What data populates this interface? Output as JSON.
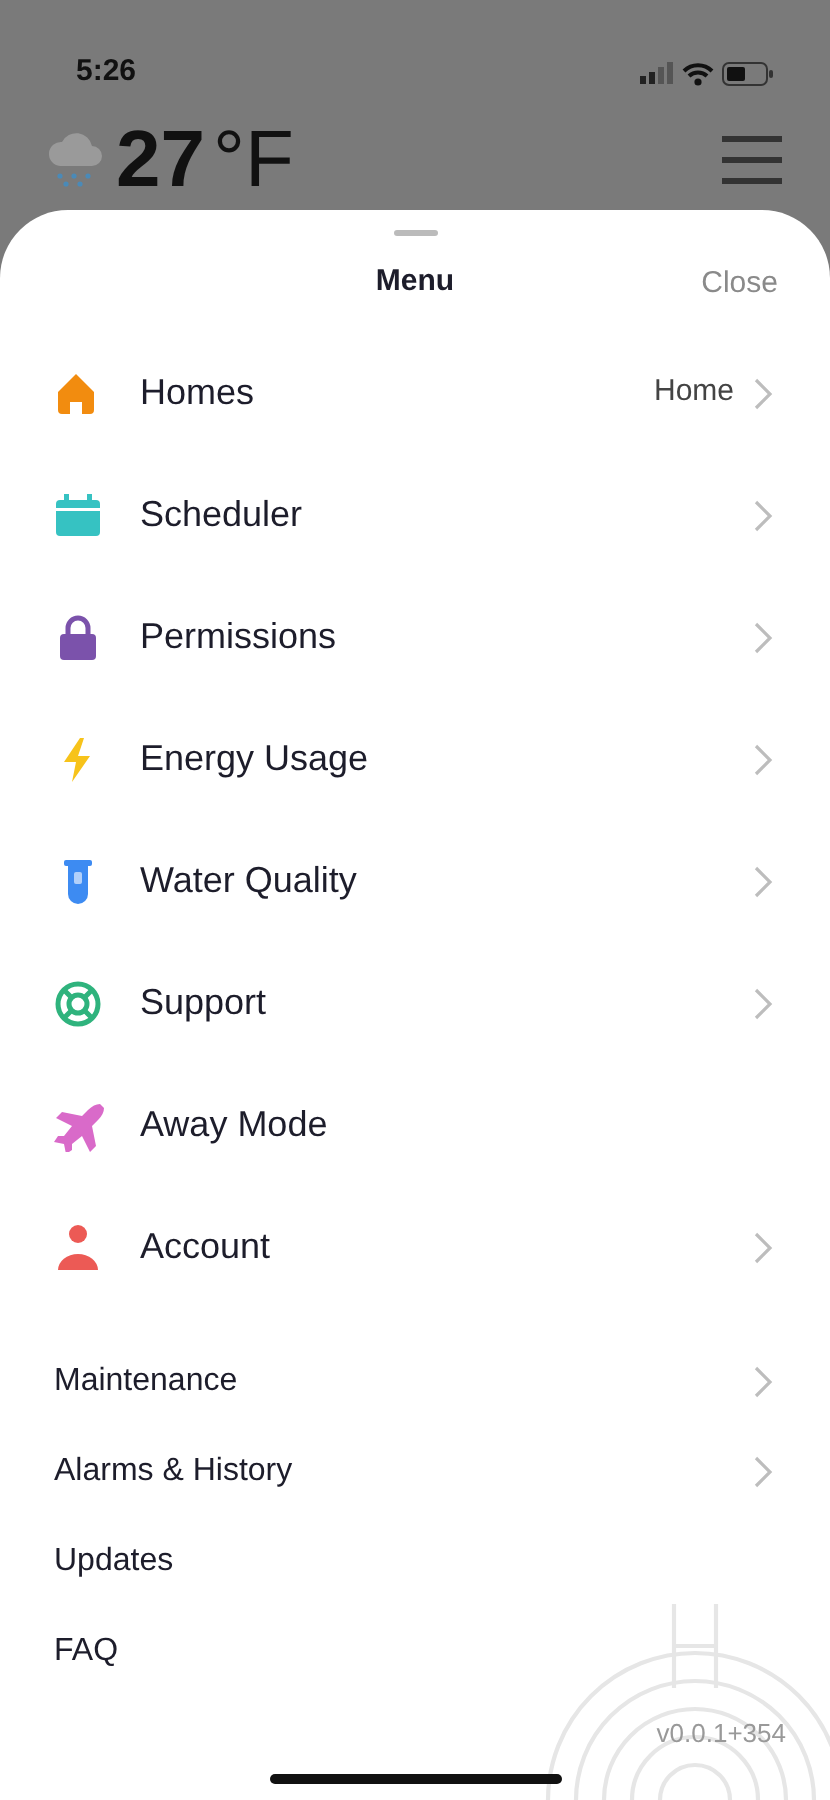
{
  "status_bar": {
    "time": "5:26"
  },
  "header": {
    "temperature": "27",
    "unit": "°F"
  },
  "sheet": {
    "title": "Menu",
    "close": "Close"
  },
  "main_items": [
    {
      "label": "Homes",
      "value": "Home",
      "chevron": true,
      "color": "#f28c0f"
    },
    {
      "label": "Scheduler",
      "chevron": true,
      "color": "#36c2c2"
    },
    {
      "label": "Permissions",
      "chevron": true,
      "color": "#7b52ab"
    },
    {
      "label": "Energy Usage",
      "chevron": true,
      "color": "#f7c31a"
    },
    {
      "label": "Water Quality",
      "chevron": true,
      "color": "#3d8bf2"
    },
    {
      "label": "Support",
      "chevron": true,
      "color": "#2fb37d"
    },
    {
      "label": "Away Mode",
      "chevron": false,
      "color": "#d96ac9"
    },
    {
      "label": "Account",
      "chevron": true,
      "color": "#ec5a55"
    }
  ],
  "secondary_items": [
    {
      "label": "Maintenance",
      "chevron": true
    },
    {
      "label": "Alarms & History",
      "chevron": true
    },
    {
      "label": "Updates",
      "chevron": false
    },
    {
      "label": "FAQ",
      "chevron": false
    }
  ],
  "version": "v0.0.1+354"
}
